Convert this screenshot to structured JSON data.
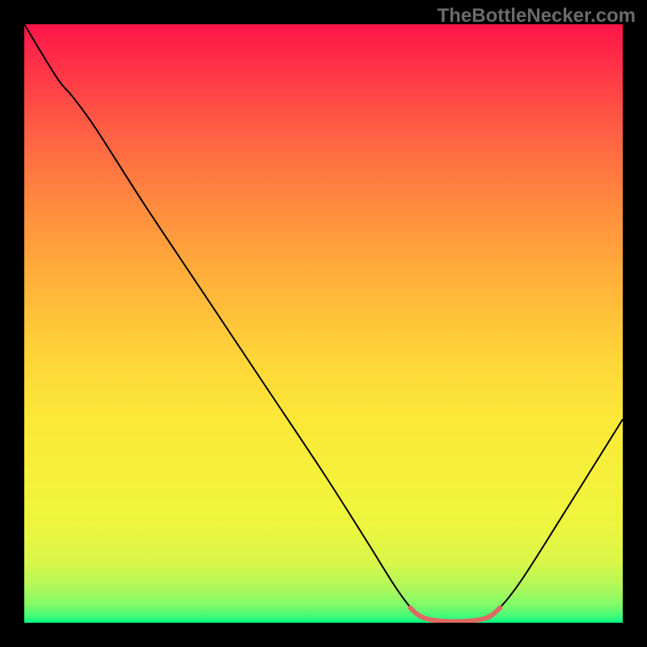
{
  "attribution": "TheBottleNecker.com",
  "chart_data": {
    "type": "line",
    "title": "",
    "xlabel": "",
    "ylabel": "",
    "xlim": [
      0,
      100
    ],
    "ylim": [
      0,
      100
    ],
    "gradient_stops": [
      {
        "pos": 0,
        "color": "#ff1449"
      },
      {
        "pos": 8,
        "color": "#ff3647"
      },
      {
        "pos": 18,
        "color": "#ff6044"
      },
      {
        "pos": 30,
        "color": "#ff8a3f"
      },
      {
        "pos": 42,
        "color": "#ffaf3a"
      },
      {
        "pos": 55,
        "color": "#ffd338"
      },
      {
        "pos": 66,
        "color": "#fbe838"
      },
      {
        "pos": 76,
        "color": "#f5f13a"
      },
      {
        "pos": 84,
        "color": "#edf53e"
      },
      {
        "pos": 90,
        "color": "#d8f74a"
      },
      {
        "pos": 94,
        "color": "#b0f859"
      },
      {
        "pos": 97,
        "color": "#82fa68"
      },
      {
        "pos": 99,
        "color": "#40fb78"
      },
      {
        "pos": 100,
        "color": "#00fb84"
      }
    ],
    "series": [
      {
        "name": "bottleneck-curve",
        "color": "#000000",
        "width": 2,
        "points": [
          {
            "x": 0.0,
            "y": 100.0
          },
          {
            "x": 5.5,
            "y": 91.0
          },
          {
            "x": 8.0,
            "y": 88.0
          },
          {
            "x": 12.0,
            "y": 82.5
          },
          {
            "x": 20.0,
            "y": 70.0
          },
          {
            "x": 30.0,
            "y": 55.0
          },
          {
            "x": 40.0,
            "y": 40.0
          },
          {
            "x": 50.0,
            "y": 25.0
          },
          {
            "x": 57.0,
            "y": 14.0
          },
          {
            "x": 62.0,
            "y": 6.0
          },
          {
            "x": 65.0,
            "y": 2.0
          },
          {
            "x": 67.0,
            "y": 0.5
          },
          {
            "x": 72.0,
            "y": 0.0
          },
          {
            "x": 77.0,
            "y": 0.5
          },
          {
            "x": 79.0,
            "y": 2.0
          },
          {
            "x": 83.0,
            "y": 7.0
          },
          {
            "x": 90.0,
            "y": 18.0
          },
          {
            "x": 100.0,
            "y": 34.0
          }
        ]
      },
      {
        "name": "highlight-segment",
        "color": "#dd6a63",
        "width": 6,
        "points": [
          {
            "x": 64.5,
            "y": 2.5
          },
          {
            "x": 66.0,
            "y": 1.2
          },
          {
            "x": 68.0,
            "y": 0.5
          },
          {
            "x": 72.0,
            "y": 0.2
          },
          {
            "x": 76.0,
            "y": 0.5
          },
          {
            "x": 78.0,
            "y": 1.2
          },
          {
            "x": 79.5,
            "y": 2.5
          }
        ]
      }
    ]
  }
}
